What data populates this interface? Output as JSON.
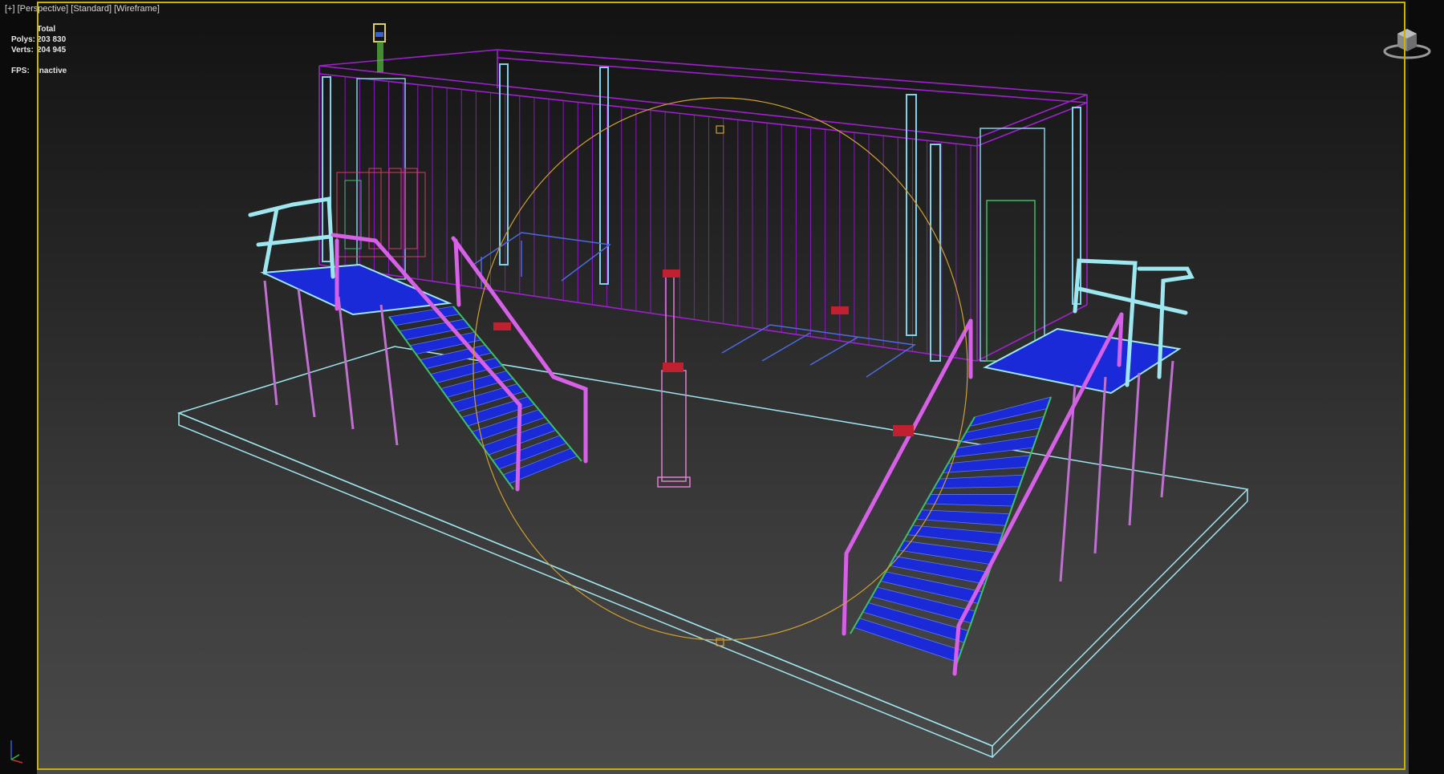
{
  "viewport": {
    "menu": "[+]",
    "view": "[Perspective]",
    "shading_mode": "[Standard]",
    "display": "[Wireframe]"
  },
  "stats": {
    "header": "Total",
    "polys_label": "Polys:",
    "polys_value": "203 830",
    "verts_label": "Verts:",
    "verts_value": "204 945",
    "fps_label": "FPS:",
    "fps_value": "Inactive"
  },
  "icons": {
    "viewcube": "viewcube-icon",
    "axis": "axis-tripod-icon"
  },
  "colors": {
    "active_viewport_border": "#c8b400",
    "container_wire": "#a020d0",
    "railing_cyan": "#9de8f0",
    "handrail_magenta": "#d860e8",
    "stair_tread_blue": "#1a2ad8",
    "stringer_green": "#3cc060",
    "base_slab": "#9fe6ee",
    "selection_gizmo": "#d0a030"
  }
}
